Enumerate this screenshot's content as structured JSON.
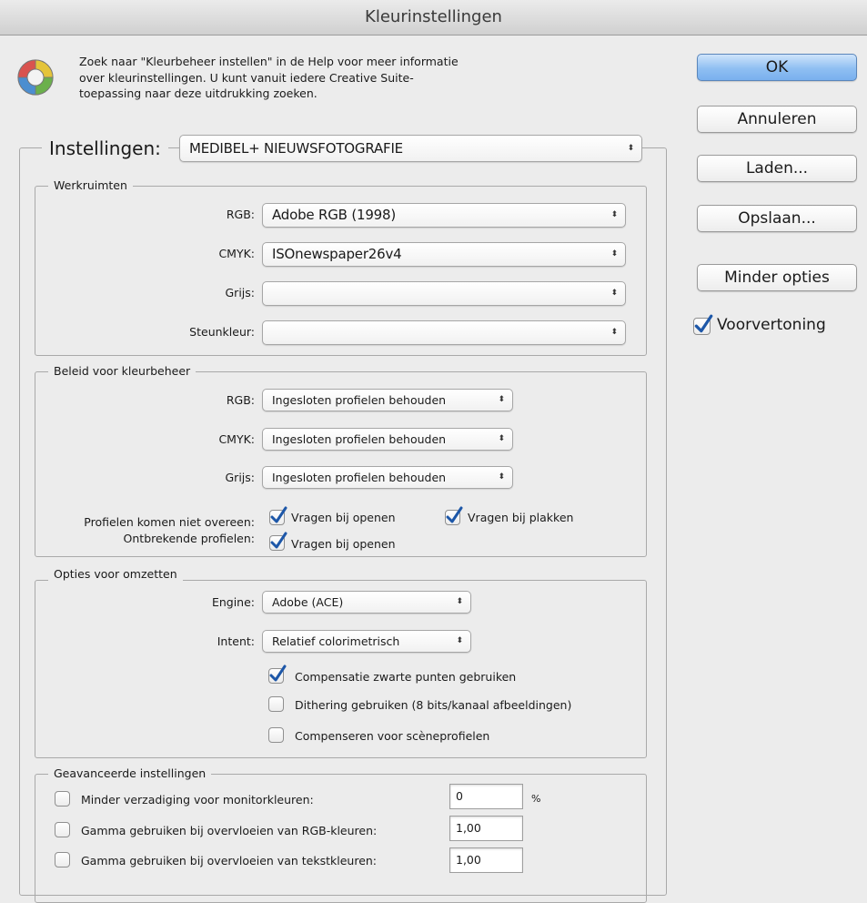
{
  "window": {
    "title": "Kleurinstellingen"
  },
  "info": {
    "icon": "color-settings-icon",
    "lines": [
      "Zoek naar \"Kleurbeheer instellen\" in de Help voor meer informatie",
      "over kleurinstellingen. U kunt vanuit iedere Creative Suite-",
      "toepassing naar deze uitdrukking zoeken."
    ]
  },
  "settings": {
    "label": "Instellingen:",
    "value": "MEDIBEL+ NIEUWSFOTOGRAFIE"
  },
  "working_spaces": {
    "title": "Werkruimten",
    "rows": [
      {
        "label": "RGB:",
        "value": "Adobe RGB (1998)"
      },
      {
        "label": "CMYK:",
        "value": "ISOnewspaper26v4"
      },
      {
        "label": "Grijs:",
        "value": ""
      },
      {
        "label": "Steunkleur:",
        "value": ""
      }
    ]
  },
  "policies": {
    "title": "Beleid voor kleurbeheer",
    "rows": [
      {
        "label": "RGB:",
        "value": "Ingesloten profielen behouden"
      },
      {
        "label": "CMYK:",
        "value": "Ingesloten profielen behouden"
      },
      {
        "label": "Grijs:",
        "value": "Ingesloten profielen behouden"
      }
    ],
    "mismatch_label": "Profielen komen niet overeen:",
    "missing_label": "Ontbrekende profielen:",
    "ask_open": {
      "label": "Vragen bij openen",
      "checked": true
    },
    "ask_paste": {
      "label": "Vragen bij plakken",
      "checked": true
    },
    "missing_ask_open": {
      "label": "Vragen bij openen",
      "checked": true
    }
  },
  "conversion": {
    "title": "Opties voor omzetten",
    "engine_label": "Engine:",
    "engine_value": "Adobe (ACE)",
    "intent_label": "Intent:",
    "intent_value": "Relatief colorimetrisch",
    "bpc": {
      "label": "Compensatie zwarte punten gebruiken",
      "checked": true
    },
    "dither": {
      "label": "Dithering gebruiken (8 bits/kanaal afbeeldingen)",
      "checked": false
    },
    "scene": {
      "label": "Compenseren voor scèneprofielen",
      "checked": false
    }
  },
  "advanced": {
    "title": "Geavanceerde instellingen",
    "desaturate": {
      "label": "Minder verzadiging voor monitorkleuren:",
      "checked": false,
      "value": "0",
      "unit": "%"
    },
    "gamma_rgb": {
      "label": "Gamma gebruiken bij overvloeien van RGB-kleuren:",
      "checked": false,
      "value": "1,00"
    },
    "gamma_text": {
      "label": "Gamma gebruiken bij overvloeien van tekstkleuren:",
      "checked": false,
      "value": "1,00"
    }
  },
  "buttons": {
    "ok": "OK",
    "cancel": "Annuleren",
    "load": "Laden...",
    "save": "Opslaan...",
    "fewer": "Minder opties",
    "preview": {
      "label": "Voorvertoning",
      "checked": true
    }
  },
  "colors": {
    "default_button": "#8fbff2",
    "check": "#1d57a8"
  }
}
